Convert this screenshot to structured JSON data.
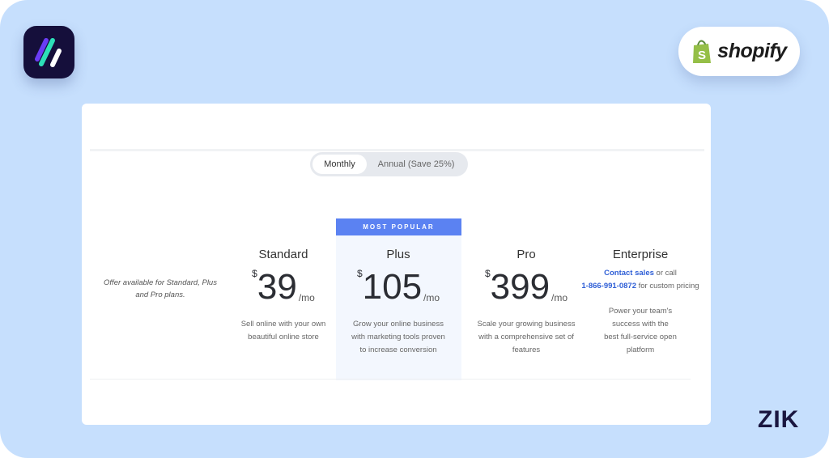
{
  "branding": {
    "app_logo": "striped-app-logo",
    "shopify_label": "shopify",
    "watermark": "ZIK",
    "colors": {
      "background": "#c6dffd",
      "accent": "#5b82f2",
      "link": "#2f5fd6",
      "shopify_green": "#95bf47"
    }
  },
  "billing_toggle": {
    "monthly": "Monthly",
    "annual": "Annual (Save 25%)",
    "selected": "Monthly"
  },
  "offer_note": "Offer available for Standard, Plus and Pro plans.",
  "plans": [
    {
      "name": "Standard",
      "currency": "$",
      "price": "39",
      "period": "/mo",
      "description": "Sell online with your own beautiful online store"
    },
    {
      "name": "Plus",
      "badge": "MOST POPULAR",
      "currency": "$",
      "price": "105",
      "period": "/mo",
      "description": "Grow your online business with marketing tools proven to increase conversion"
    },
    {
      "name": "Pro",
      "currency": "$",
      "price": "399",
      "period": "/mo",
      "description": "Scale your growing business with a comprehensive set of features"
    },
    {
      "name": "Enterprise",
      "contact_link": "Contact sales",
      "contact_text1": " or call ",
      "phone": "1-866-991-0872",
      "contact_text2": " for custom pricing",
      "description": "Power your team's success with the best full-service open platform"
    }
  ]
}
